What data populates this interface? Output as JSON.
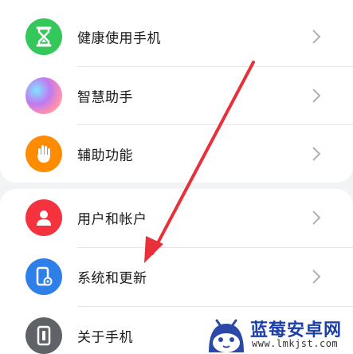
{
  "menu": {
    "group1": [
      {
        "label": "健康使用手机",
        "icon": "hourglass-icon",
        "color": "#34c759"
      },
      {
        "label": "智慧助手",
        "icon": "assistant-orb-icon",
        "color": "#b98ee8"
      },
      {
        "label": "辅助功能",
        "icon": "hand-icon",
        "color": "#ff8c00"
      }
    ],
    "group2": [
      {
        "label": "用户和帐户",
        "icon": "user-icon",
        "color": "#f5333f"
      },
      {
        "label": "系统和更新",
        "icon": "phone-settings-icon",
        "color": "#2f7fe8"
      },
      {
        "label": "关于手机",
        "icon": "phone-icon",
        "color": "#5f6368"
      }
    ]
  },
  "colors": {
    "annotation_arrow": "#e8303a",
    "watermark_text": "#1c3fa8"
  },
  "watermark": {
    "title": "蓝莓安卓网",
    "url": "www.lmkjst.com"
  }
}
